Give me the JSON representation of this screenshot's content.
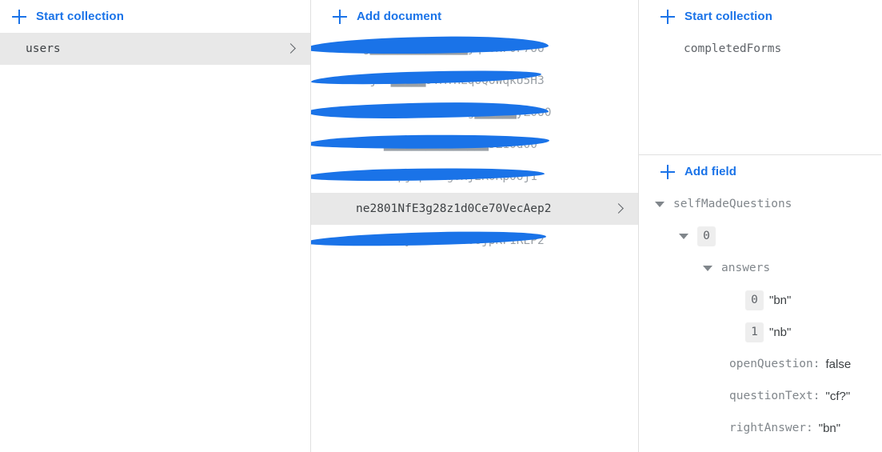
{
  "collections_panel": {
    "action": {
      "label": "Start collection",
      "icon": "plus-icon"
    },
    "items": [
      {
        "name": "users",
        "selected": true,
        "redacted": false
      }
    ]
  },
  "documents_panel": {
    "action": {
      "label": "Add document",
      "icon": "plus-icon"
    },
    "items": [
      {
        "name": "Ag██████████████jq7oHF0F7oo",
        "selected": false,
        "redacted": true
      },
      {
        "name": "a7jo2█████9TMTHLqoQoWqkU5H3",
        "selected": false,
        "redacted": true
      },
      {
        "name": "PQ2F0BV0F0QC9N41g██████yZ0o0",
        "selected": false,
        "redacted": true
      },
      {
        "name": "HT2A███████████████5Z10d00",
        "selected": false,
        "redacted": true
      },
      {
        "name": "2fGHP0pj0p5HRgoxj2R0Rp0oj1",
        "selected": false,
        "redacted": true
      },
      {
        "name": "ne2801NfE3g28z1d0Ce70VecAep2",
        "selected": true,
        "redacted": false
      },
      {
        "name": "WoKFUU1y10F0u2Rb0ojpKF1REP2",
        "selected": false,
        "redacted": true
      }
    ]
  },
  "detail_panel": {
    "subcollections": {
      "action": {
        "label": "Start collection",
        "icon": "plus-icon"
      },
      "items": [
        {
          "name": "completedForms"
        }
      ]
    },
    "fields": {
      "action": {
        "label": "Add field",
        "icon": "plus-icon"
      },
      "rows": [
        {
          "indent": 0,
          "caret": "expanded",
          "kind": "key",
          "key": "selfMadeQuestions"
        },
        {
          "indent": 1,
          "caret": "expanded",
          "kind": "index",
          "key": "0"
        },
        {
          "indent": 2,
          "caret": "expanded",
          "kind": "key",
          "key": "answers"
        },
        {
          "indent": 3,
          "caret": "none",
          "kind": "index_value",
          "key": "0",
          "value": "\"bn\""
        },
        {
          "indent": 3,
          "caret": "none",
          "kind": "index_value",
          "key": "1",
          "value": "\"nb\""
        },
        {
          "indent": 2,
          "caret": "none",
          "kind": "key_value",
          "key": "openQuestion",
          "sep": ":",
          "value": "false"
        },
        {
          "indent": 2,
          "caret": "none",
          "kind": "key_value",
          "key": "questionText",
          "sep": ":",
          "value": "\"cf?\""
        },
        {
          "indent": 2,
          "caret": "none",
          "kind": "key_value",
          "key": "rightAnswer",
          "sep": ":",
          "value": "\"bn\""
        }
      ]
    }
  },
  "colors": {
    "accent": "#1a73e8",
    "selected_row_bg": "#e8e8e8",
    "text_secondary": "#5f6368",
    "divider": "#e0e0e0"
  }
}
